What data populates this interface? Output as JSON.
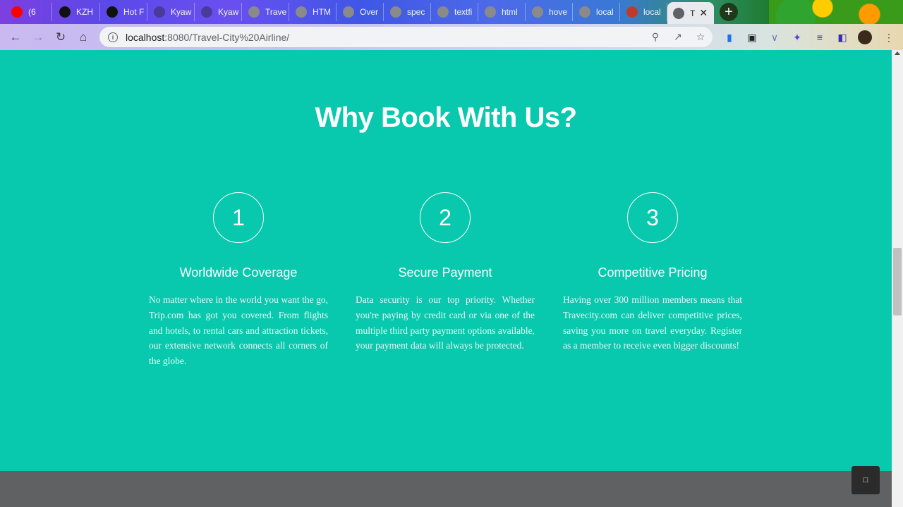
{
  "browser": {
    "tabs": [
      {
        "label": "(6",
        "icon": "youtube-icon",
        "color": "#ff0000"
      },
      {
        "label": "KZH",
        "icon": "github-icon",
        "color": "#111111"
      },
      {
        "label": "Hot F",
        "icon": "circle-logo-icon",
        "color": "#111111"
      },
      {
        "label": "Kyaw",
        "icon": "k-logo-icon",
        "color": "#4a3a9a"
      },
      {
        "label": "Kyaw",
        "icon": "k-logo-icon",
        "color": "#4a3a9a"
      },
      {
        "label": "Trave",
        "icon": "globe-icon",
        "color": "#8a8a8a"
      },
      {
        "label": "HTM",
        "icon": "globe-icon",
        "color": "#8a8a8a"
      },
      {
        "label": "Over",
        "icon": "globe-icon",
        "color": "#8a8a8a"
      },
      {
        "label": "spec",
        "icon": "globe-icon",
        "color": "#8a8a8a"
      },
      {
        "label": "textfi",
        "icon": "globe-icon",
        "color": "#8a8a8a"
      },
      {
        "label": "html",
        "icon": "globe-icon",
        "color": "#8a8a8a"
      },
      {
        "label": "hove",
        "icon": "globe-icon",
        "color": "#8a8a8a"
      },
      {
        "label": "local",
        "icon": "globe-icon",
        "color": "#8a8a8a"
      },
      {
        "label": "local",
        "icon": "image-icon",
        "color": "#c0392b"
      },
      {
        "label": "T",
        "icon": "globe-icon",
        "color": "#5f6368",
        "active": true
      }
    ],
    "url": {
      "host": "localhost",
      "rest": ":8080/Travel-City%20Airline/"
    }
  },
  "section": {
    "title": "Why Book With Us?",
    "features": [
      {
        "number": "1",
        "heading": "Worldwide Coverage",
        "text": "No matter where in the world you want the go, Trip.com has got you covered. From flights and hotels, to rental cars and attraction tickets, our extensive network connects all corners of the globe."
      },
      {
        "number": "2",
        "heading": "Secure Payment",
        "text": "Data security is our top priority. Whether you're paying by credit card or via one of the multiple third party payment options available, your payment data will always be protected."
      },
      {
        "number": "3",
        "heading": "Competitive Pricing",
        "text": "Having over 300 million members means that Travecity.com can deliver competitive prices, saving you more on travel everyday. Register as a member to receive even bigger discounts!"
      }
    ]
  },
  "colors": {
    "page_background": "#08c8ad",
    "footer": "#5f6162"
  }
}
